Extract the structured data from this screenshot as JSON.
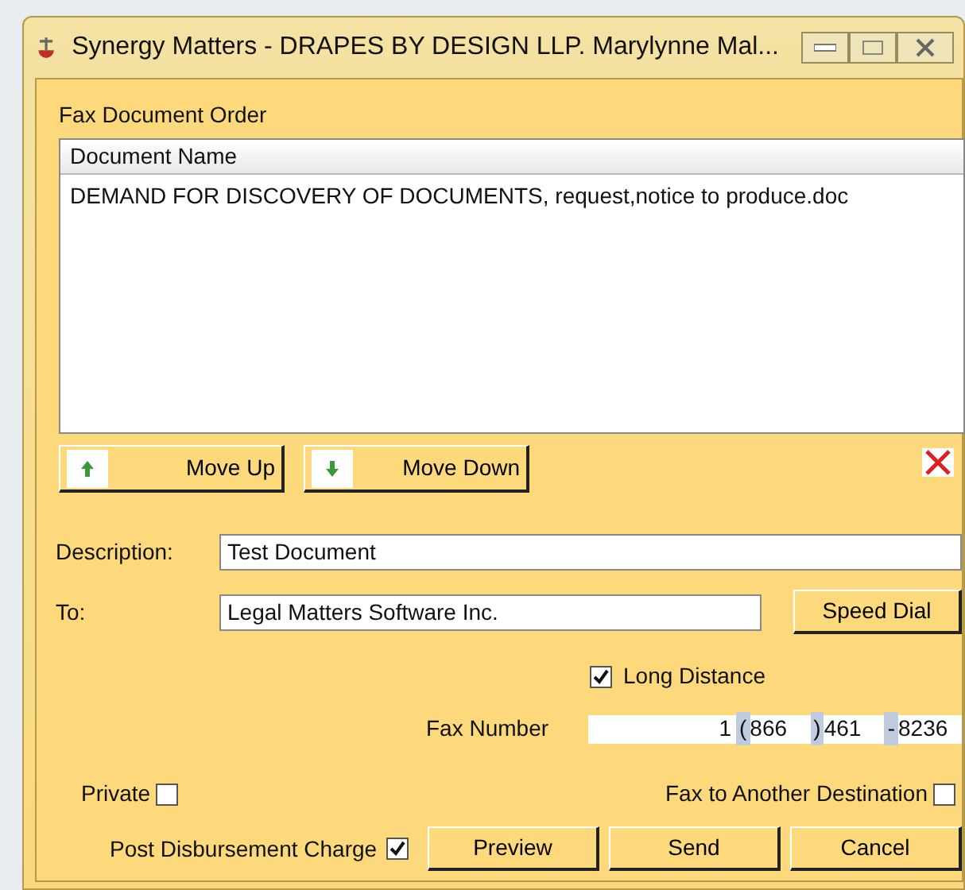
{
  "window": {
    "title": "Synergy Matters - DRAPES BY DESIGN LLP. Marylynne Mal..."
  },
  "group_label": "Fax Document Order",
  "document_list": {
    "columns": [
      "Document Name"
    ],
    "rows": [
      {
        "document_name": "DEMAND FOR DISCOVERY OF DOCUMENTS, request,notice to produce.doc",
        "selected": false
      }
    ]
  },
  "move_buttons": [
    {
      "label": "Move Up",
      "kind": "up"
    },
    {
      "label": "Move Down",
      "kind": "down"
    }
  ],
  "description": {
    "label": "Description:",
    "value": "Test Document"
  },
  "to": {
    "label": "To:",
    "value": "Legal Matters Software Inc."
  },
  "speed_dial_button": "Speed Dial",
  "long_distance": {
    "label": "Long Distance",
    "checked": true
  },
  "fax_number": {
    "label": "Fax Number",
    "country": "1",
    "open_paren": "(",
    "area": "866",
    "close_paren": ")",
    "prefix": "461",
    "dash": "-",
    "line": "8236"
  },
  "private": {
    "label": "Private",
    "checked": false
  },
  "fax_to_another_destination": {
    "label": "Fax to Another Destination",
    "checked": false
  },
  "post_disbursement_charge": {
    "label": "Post Disbursement Charge",
    "checked": true
  },
  "buttons": [
    "Preview",
    "Send",
    "Cancel"
  ]
}
